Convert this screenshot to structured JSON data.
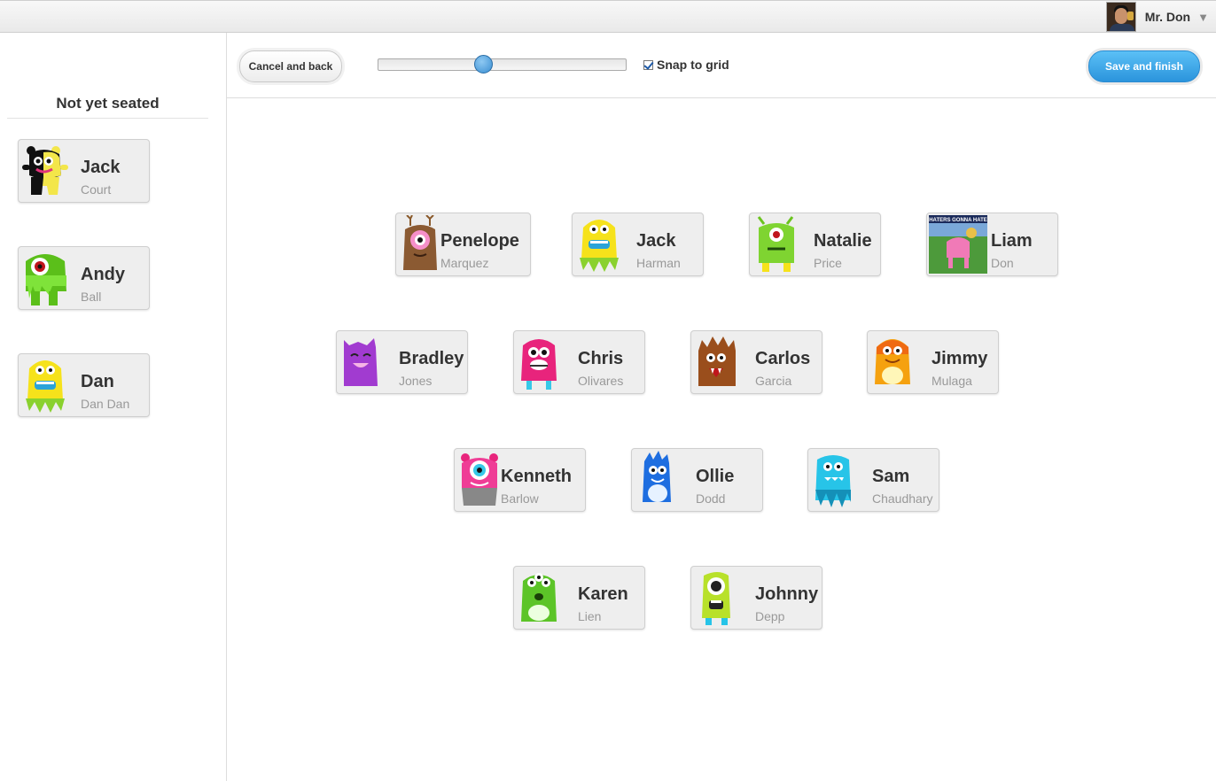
{
  "user": {
    "name": "Mr. Don",
    "caret": "▼"
  },
  "sidebar": {
    "title": "Not yet seated"
  },
  "toolbar": {
    "cancel_label": "Cancel and back",
    "snap_label": "Snap to grid",
    "snap_checked": true,
    "save_label": "Save and finish",
    "zoom_fraction": 0.42
  },
  "colors": {
    "accent": "#2b94dc",
    "card_bg": "#eeeeee"
  },
  "unseated": [
    {
      "first": "Jack",
      "last": "Court",
      "icon": "black-yellow-monster-icon"
    },
    {
      "first": "Andy",
      "last": "Ball",
      "icon": "green-cyclops-monster-icon"
    },
    {
      "first": "Dan",
      "last": "Dan Dan",
      "icon": "yellow-monster-icon"
    }
  ],
  "seated": [
    {
      "first": "Penelope",
      "last": "Marquez",
      "icon": "brown-antler-monster-icon"
    },
    {
      "first": "Jack",
      "last": "Harman",
      "icon": "yellow-monster-icon"
    },
    {
      "first": "Natalie",
      "last": "Price",
      "icon": "green-antenna-monster-icon"
    },
    {
      "first": "Liam",
      "last": "Don",
      "icon": "custom-photo-avatar-icon",
      "photo_text": "HATERS GONNA HATE"
    },
    {
      "first": "Bradley",
      "last": "Jones",
      "icon": "purple-monster-icon"
    },
    {
      "first": "Chris",
      "last": "Olivares",
      "icon": "pink-monster-icon"
    },
    {
      "first": "Carlos",
      "last": "Garcia",
      "icon": "brown-furry-monster-icon"
    },
    {
      "first": "Jimmy",
      "last": "Mulaga",
      "icon": "orange-monster-icon"
    },
    {
      "first": "Kenneth",
      "last": "Barlow",
      "icon": "pink-cyclops-monster-icon"
    },
    {
      "first": "Ollie",
      "last": "Dodd",
      "icon": "blue-monster-icon"
    },
    {
      "first": "Sam",
      "last": "Chaudhary",
      "icon": "cyan-monster-icon"
    },
    {
      "first": "Karen",
      "last": "Lien",
      "icon": "green-three-eyed-monster-icon"
    },
    {
      "first": "Johnny",
      "last": "Depp",
      "icon": "lime-cyclops-monster-icon"
    }
  ]
}
